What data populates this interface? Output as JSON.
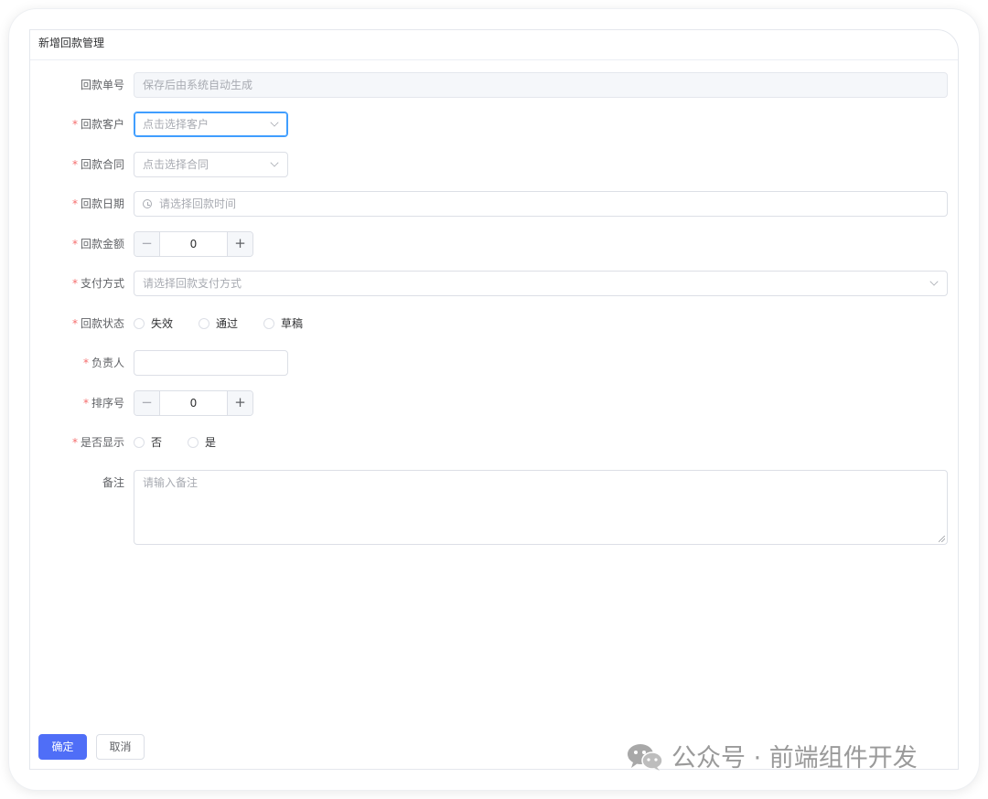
{
  "dialog": {
    "title": "新增回款管理"
  },
  "form": {
    "receipt_no": {
      "label": "回款单号",
      "placeholder": "保存后由系统自动生成"
    },
    "customer": {
      "label": "回款客户",
      "placeholder": "点击选择客户"
    },
    "contract": {
      "label": "回款合同",
      "placeholder": "点击选择合同"
    },
    "date": {
      "label": "回款日期",
      "placeholder": "请选择回款时间"
    },
    "amount": {
      "label": "回款金额",
      "value": "0",
      "minus": "−",
      "plus": "+"
    },
    "payment_method": {
      "label": "支付方式",
      "placeholder": "请选择回款支付方式"
    },
    "status": {
      "label": "回款状态",
      "options": [
        "失效",
        "通过",
        "草稿"
      ]
    },
    "owner": {
      "label": "负责人",
      "value": ""
    },
    "sort": {
      "label": "排序号",
      "value": "0",
      "minus": "−",
      "plus": "+"
    },
    "visible": {
      "label": "是否显示",
      "options": [
        "否",
        "是"
      ]
    },
    "remark": {
      "label": "备注",
      "placeholder": "请输入备注"
    },
    "required_mark": "*"
  },
  "footer": {
    "confirm": "确定",
    "cancel": "取消"
  },
  "watermark": {
    "text": "公众号 · 前端组件开发",
    "icon": "wechat-icon"
  },
  "colors": {
    "primary": "#4f6ef7",
    "required": "#f56c6c",
    "focus": "#409eff",
    "border": "#dcdfe6"
  }
}
